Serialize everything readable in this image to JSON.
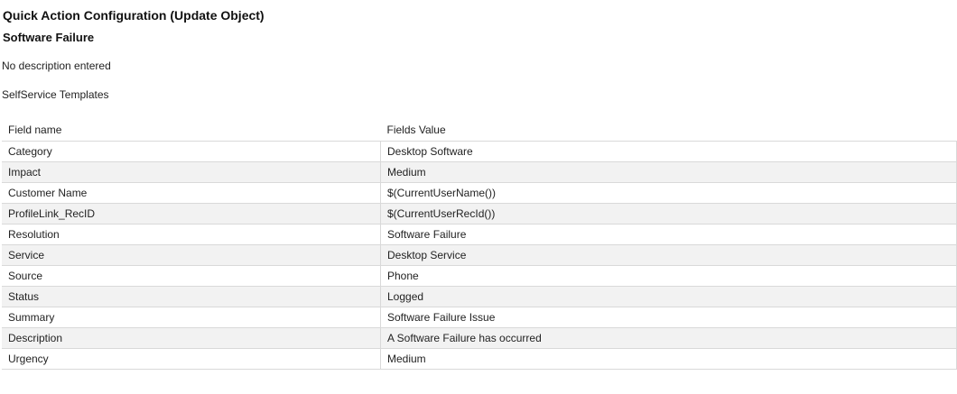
{
  "header": {
    "title": "Quick Action Configuration (Update Object)",
    "action_name": "Software Failure"
  },
  "description": "No description entered",
  "template_label": "SelfService Templates",
  "table": {
    "columns": [
      "Field name",
      "Fields Value"
    ],
    "rows": [
      {
        "field": "Category",
        "value": "Desktop Software"
      },
      {
        "field": "Impact",
        "value": "Medium"
      },
      {
        "field": "Customer Name",
        "value": "$(CurrentUserName())"
      },
      {
        "field": "ProfileLink_RecID",
        "value": "$(CurrentUserRecId())"
      },
      {
        "field": "Resolution",
        "value": "Software Failure"
      },
      {
        "field": "Service",
        "value": "Desktop Service"
      },
      {
        "field": "Source",
        "value": "Phone"
      },
      {
        "field": "Status",
        "value": "Logged"
      },
      {
        "field": "Summary",
        "value": "Software Failure Issue"
      },
      {
        "field": "Description",
        "value": "A Software Failure has occurred"
      },
      {
        "field": "Urgency",
        "value": "Medium"
      }
    ]
  }
}
